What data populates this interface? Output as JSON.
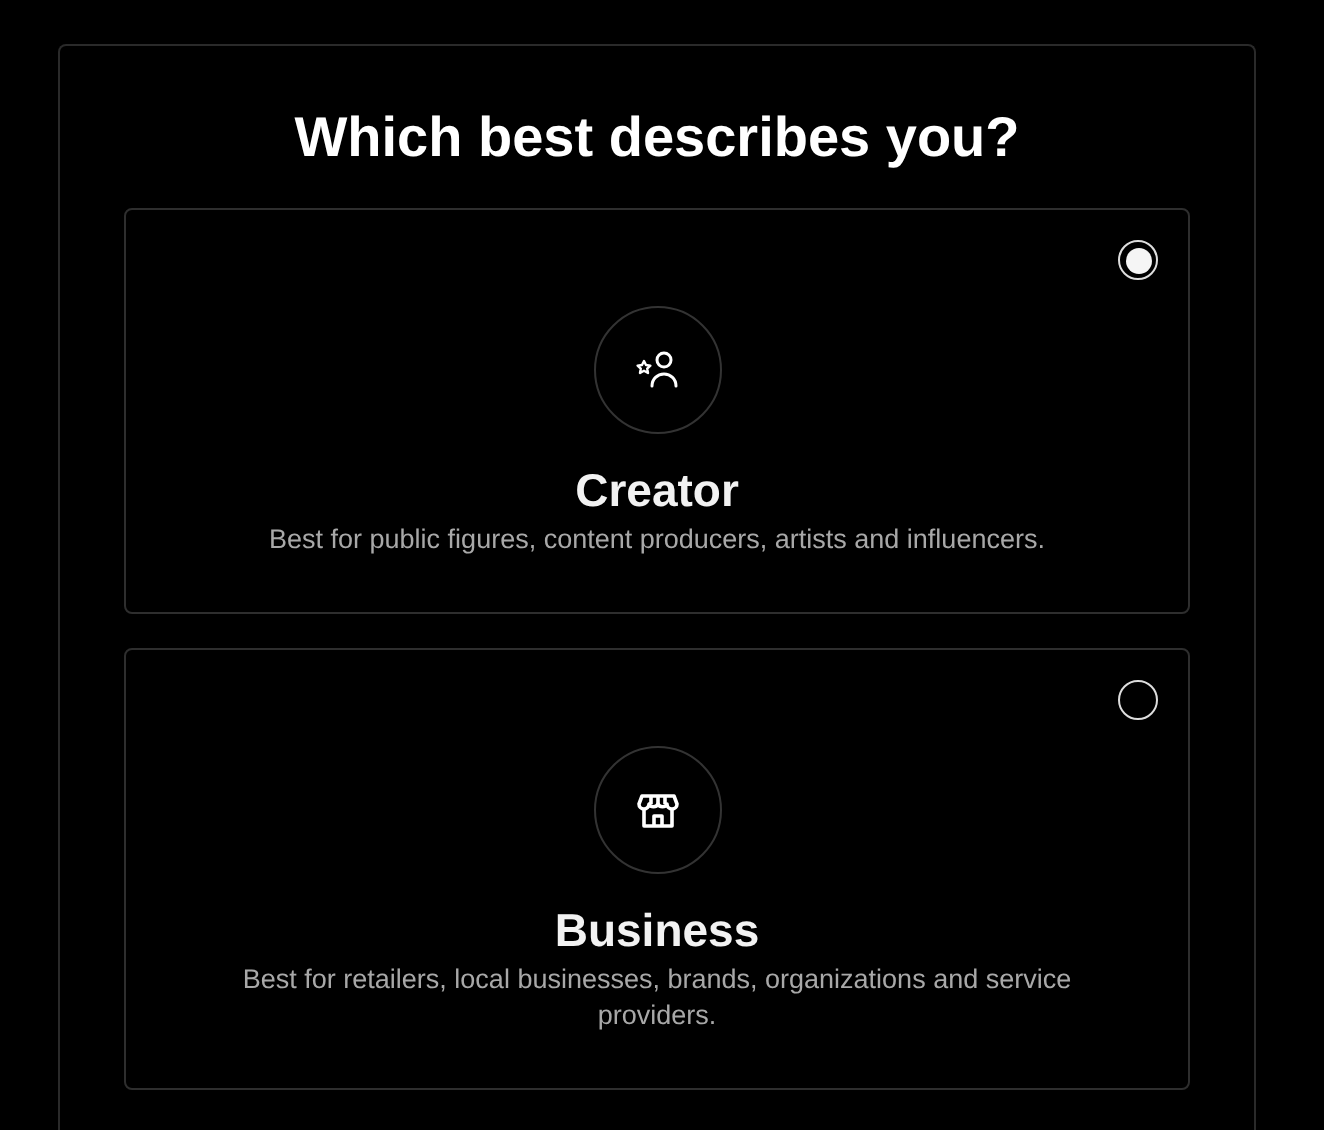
{
  "heading": "Which best describes you?",
  "options": [
    {
      "kind": "creator",
      "title": "Creator",
      "description": "Best for public figures, content producers, artists and influencers.",
      "selected": true
    },
    {
      "kind": "business",
      "title": "Business",
      "description": "Best for retailers, local businesses, brands, organizations and service providers.",
      "selected": false
    }
  ]
}
